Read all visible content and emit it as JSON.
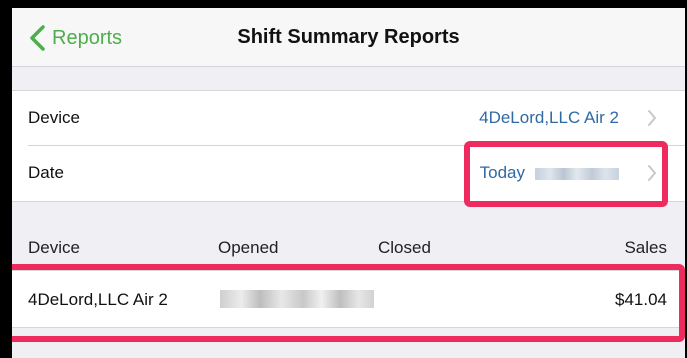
{
  "nav": {
    "back_label": "Reports",
    "title": "Shift Summary Reports"
  },
  "settings": {
    "device_label": "Device",
    "device_value": "4DeLord,LLC Air 2",
    "date_label": "Date",
    "date_value": "Today"
  },
  "table": {
    "headers": {
      "device": "Device",
      "opened": "Opened",
      "closed": "Closed",
      "sales": "Sales"
    },
    "rows": [
      {
        "device": "4DeLord,LLC Air 2",
        "closed": "",
        "sales": "$41.04"
      }
    ]
  },
  "colors": {
    "accent": "#4cae4c",
    "link": "#2f6aa5",
    "highlight": "#ee2b5e",
    "background": "#efeff4"
  }
}
